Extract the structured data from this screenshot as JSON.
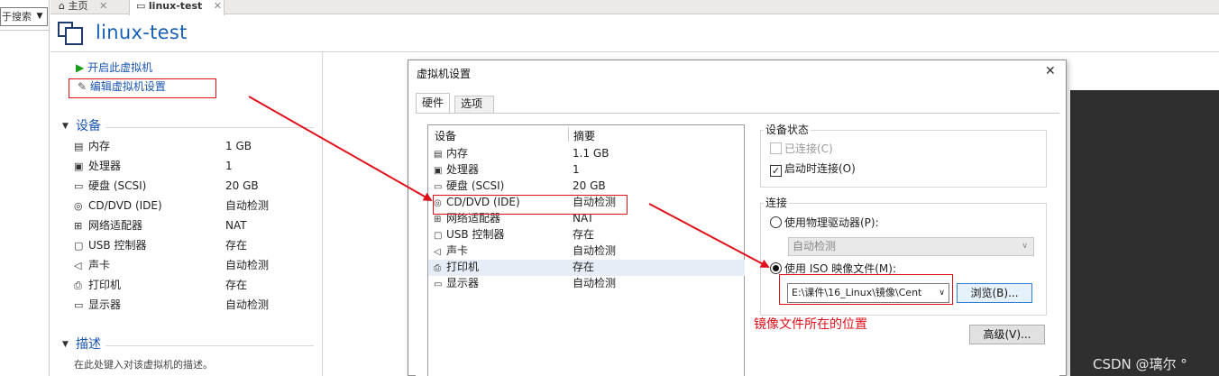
{
  "search": {
    "placeholder": "在此处键入内容进行搜索",
    "visible_text": "于搜索"
  },
  "tabs": [
    {
      "label": "主页"
    },
    {
      "label": "linux-test"
    }
  ],
  "vm": {
    "title": "linux-test"
  },
  "actions": {
    "power_on": "开启此虚拟机",
    "edit_settings": "编辑虚拟机设置"
  },
  "devices_section": {
    "title": "设备",
    "items": [
      {
        "icon": "memory-icon",
        "name": "内存",
        "value": "1 GB"
      },
      {
        "icon": "cpu-icon",
        "name": "处理器",
        "value": "1"
      },
      {
        "icon": "disk-icon",
        "name": "硬盘 (SCSI)",
        "value": "20 GB"
      },
      {
        "icon": "cd-icon",
        "name": "CD/DVD (IDE)",
        "value": "自动检测"
      },
      {
        "icon": "network-icon",
        "name": "网络适配器",
        "value": "NAT"
      },
      {
        "icon": "usb-icon",
        "name": "USB 控制器",
        "value": "存在"
      },
      {
        "icon": "sound-icon",
        "name": "声卡",
        "value": "自动检测"
      },
      {
        "icon": "printer-icon",
        "name": "打印机",
        "value": "存在"
      },
      {
        "icon": "display-icon",
        "name": "显示器",
        "value": "自动检测"
      }
    ]
  },
  "description_section": {
    "title": "描述",
    "placeholder": "在此处键入对该虚拟机的描述。"
  },
  "dialog": {
    "title": "虚拟机设置",
    "close": "✕",
    "tabs": [
      {
        "label": "硬件"
      },
      {
        "label": "选项"
      }
    ],
    "list_headers": {
      "device": "设备",
      "summary": "摘要"
    },
    "list": [
      {
        "icon": "memory-icon",
        "name": "内存",
        "value": "1.1 GB"
      },
      {
        "icon": "cpu-icon",
        "name": "处理器",
        "value": "1"
      },
      {
        "icon": "disk-icon",
        "name": "硬盘 (SCSI)",
        "value": "20 GB"
      },
      {
        "icon": "cd-icon",
        "name": "CD/DVD (IDE)",
        "value": "自动检测"
      },
      {
        "icon": "network-icon",
        "name": "网络适配器",
        "value": "NAT"
      },
      {
        "icon": "usb-icon",
        "name": "USB 控制器",
        "value": "存在"
      },
      {
        "icon": "sound-icon",
        "name": "声卡",
        "value": "自动检测"
      },
      {
        "icon": "printer-icon",
        "name": "打印机",
        "value": "存在"
      },
      {
        "icon": "display-icon",
        "name": "显示器",
        "value": "自动检测"
      }
    ],
    "device_status": {
      "title": "设备状态",
      "connected": "已连接(C)",
      "connect_at_power_on": "启动时连接(O)"
    },
    "connection": {
      "title": "连接",
      "physical_drive": "使用物理驱动器(P):",
      "physical_value": "自动检测",
      "iso_file": "使用 ISO 映像文件(M):",
      "iso_path": "E:\\课件\\16_Linux\\镜像\\Cent",
      "browse": "浏览(B)..."
    },
    "advanced": "高级(V)..."
  },
  "annotation": {
    "iso_note": "镜像文件所在的位置",
    "color": "#e0101a"
  },
  "watermark": "CSDN @璃尔 °",
  "colors": {
    "accent": "#1660b5",
    "highlight": "#e0101a",
    "play": "#1a9a1a"
  }
}
